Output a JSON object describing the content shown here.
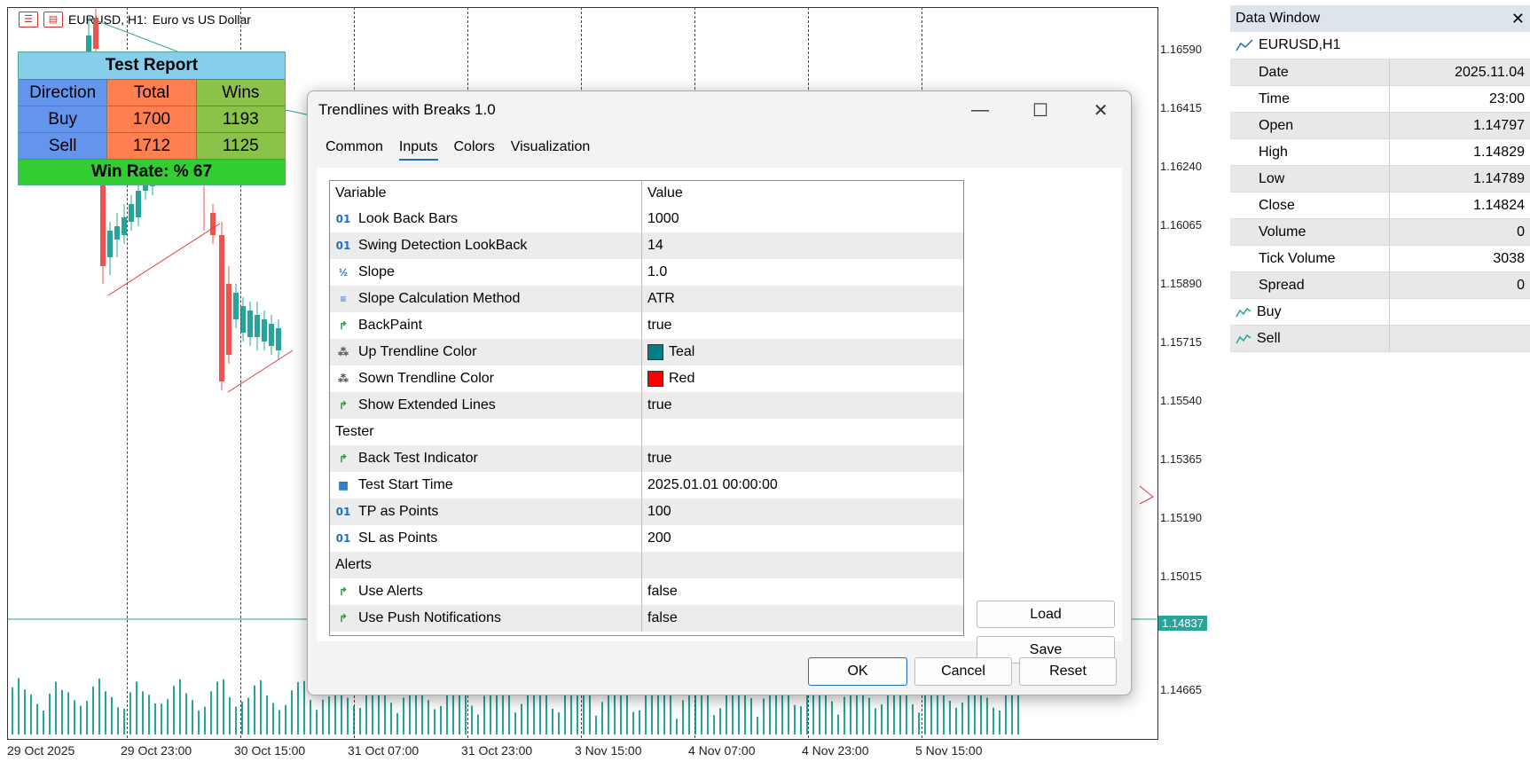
{
  "chart": {
    "symbol": "EURUSD, H1:",
    "description": "Euro vs US Dollar",
    "price_labels": [
      "1.16590",
      "1.16415",
      "1.16240",
      "1.16065",
      "1.15890",
      "1.15715",
      "1.15540",
      "1.15365",
      "1.15190",
      "1.15015",
      "1.14665"
    ],
    "current_price": "1.14837",
    "time_labels": [
      "29 Oct 2025",
      "29 Oct 23:00",
      "30 Oct 15:00",
      "31 Oct 07:00",
      "31 Oct 23:00",
      "3 Nov 15:00",
      "4 Nov 07:00",
      "4 Nov 23:00",
      "5 Nov 15:00"
    ],
    "colors": {
      "bull": "#26a69a",
      "bear": "#ef5350",
      "trend": "#e53935",
      "volume": "#26a69a"
    }
  },
  "test_report": {
    "title": "Test Report",
    "headers": [
      "Direction",
      "Total",
      "Wins"
    ],
    "rows": [
      {
        "direction": "Buy",
        "total": "1700",
        "wins": "1193"
      },
      {
        "direction": "Sell",
        "total": "1712",
        "wins": "1125"
      }
    ],
    "footer": "Win Rate: %  67"
  },
  "data_window": {
    "title": "Data Window",
    "symbol": "EURUSD,H1",
    "rows": [
      {
        "label": "Date",
        "value": "2025.11.04"
      },
      {
        "label": "Time",
        "value": "23:00"
      },
      {
        "label": "Open",
        "value": "1.14797"
      },
      {
        "label": "High",
        "value": "1.14829"
      },
      {
        "label": "Low",
        "value": "1.14789"
      },
      {
        "label": "Close",
        "value": "1.14824"
      },
      {
        "label": "Volume",
        "value": "0"
      },
      {
        "label": "Tick Volume",
        "value": "3038"
      },
      {
        "label": "Spread",
        "value": "0"
      }
    ],
    "series": [
      {
        "label": "Buy",
        "value": ""
      },
      {
        "label": "Sell",
        "value": ""
      }
    ]
  },
  "dialog": {
    "title": "Trendlines with Breaks 1.0",
    "tabs": [
      "Common",
      "Inputs",
      "Colors",
      "Visualization"
    ],
    "active_tab": "Inputs",
    "grid_headers": {
      "variable": "Variable",
      "value": "Value"
    },
    "rows": [
      {
        "icon": "int-icon",
        "variable": "Look Back Bars",
        "value": "1000"
      },
      {
        "icon": "int-icon",
        "variable": "Swing Detection LookBack",
        "value": "14"
      },
      {
        "icon": "double-icon",
        "variable": "Slope",
        "value": "1.0"
      },
      {
        "icon": "enum-icon",
        "variable": "Slope Calculation Method",
        "value": "ATR"
      },
      {
        "icon": "bool-icon",
        "variable": "BackPaint",
        "value": "true"
      },
      {
        "icon": "color-icon",
        "variable": "Up Trendline Color",
        "value": "Teal",
        "swatch": "#008080"
      },
      {
        "icon": "color-icon",
        "variable": "Sown Trendline Color",
        "value": "Red",
        "swatch": "#ff0000"
      },
      {
        "icon": "bool-icon",
        "variable": "Show Extended Lines",
        "value": "true"
      },
      {
        "icon": "",
        "variable": "Tester",
        "value": ""
      },
      {
        "icon": "bool-icon",
        "variable": "Back Test Indicator",
        "value": "true"
      },
      {
        "icon": "calendar-icon",
        "variable": "Test Start Time",
        "value": "2025.01.01 00:00:00"
      },
      {
        "icon": "int-icon",
        "variable": "TP as Points",
        "value": "100"
      },
      {
        "icon": "int-icon",
        "variable": "SL as Points",
        "value": "200"
      },
      {
        "icon": "",
        "variable": "Alerts",
        "value": ""
      },
      {
        "icon": "bool-icon",
        "variable": "Use Alerts",
        "value": "false"
      },
      {
        "icon": "bool-icon",
        "variable": "Use Push Notifications",
        "value": "false"
      }
    ],
    "buttons": {
      "load": "Load",
      "save": "Save",
      "ok": "OK",
      "cancel": "Cancel",
      "reset": "Reset"
    }
  }
}
